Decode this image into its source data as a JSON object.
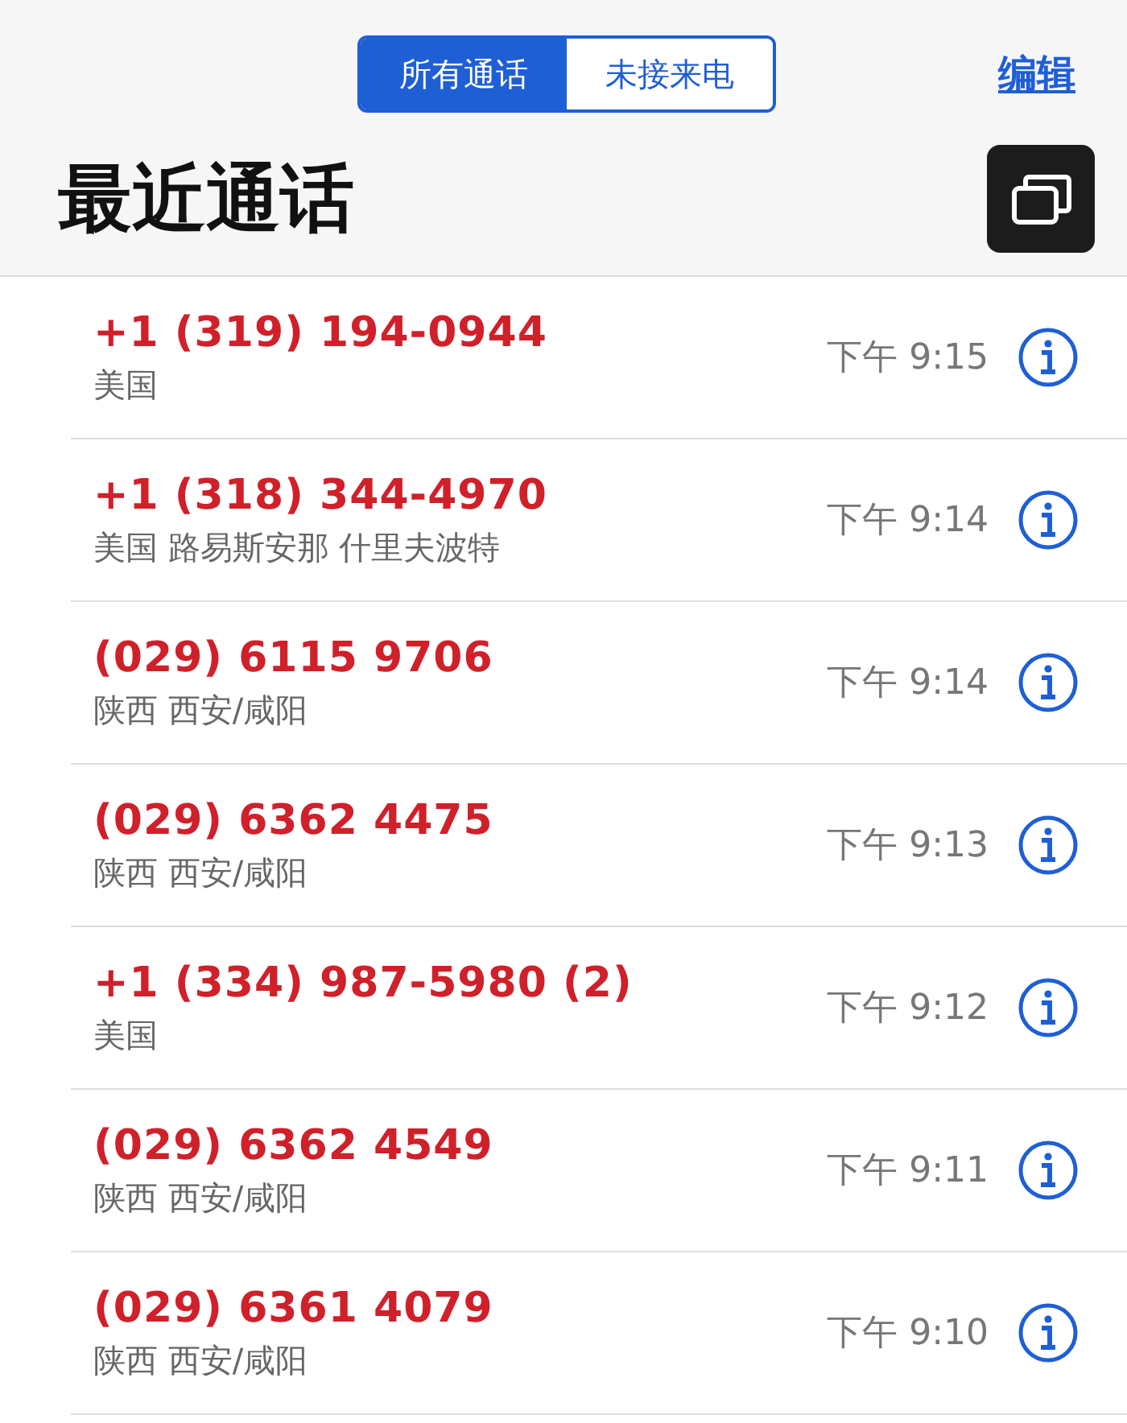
{
  "segments": [
    {
      "label": "所有通话",
      "selected": true
    },
    {
      "label": "未接来电",
      "selected": false
    }
  ],
  "edit_button": "编辑",
  "title": "最近通话",
  "calls": [
    {
      "number": "+1 (319) 194-0944",
      "location": "美国",
      "time": "下午 9:15",
      "missed": true
    },
    {
      "number": "+1 (318) 344-4970",
      "location": "美国 路易斯安那 什里夫波特",
      "time": "下午 9:14",
      "missed": true
    },
    {
      "number": "(029) 6115 9706",
      "location": "陕西 西安/咸阳",
      "time": "下午 9:14",
      "missed": true
    },
    {
      "number": "(029) 6362 4475",
      "location": "陕西 西安/咸阳",
      "time": "下午 9:13",
      "missed": true
    },
    {
      "number": "+1 (334) 987-5980 (2)",
      "location": "美国",
      "time": "下午 9:12",
      "missed": true
    },
    {
      "number": "(029) 6362 4549",
      "location": "陕西 西安/咸阳",
      "time": "下午 9:11",
      "missed": true
    },
    {
      "number": "(029) 6361 4079",
      "location": "陕西 西安/咸阳",
      "time": "下午 9:10",
      "missed": true
    }
  ]
}
